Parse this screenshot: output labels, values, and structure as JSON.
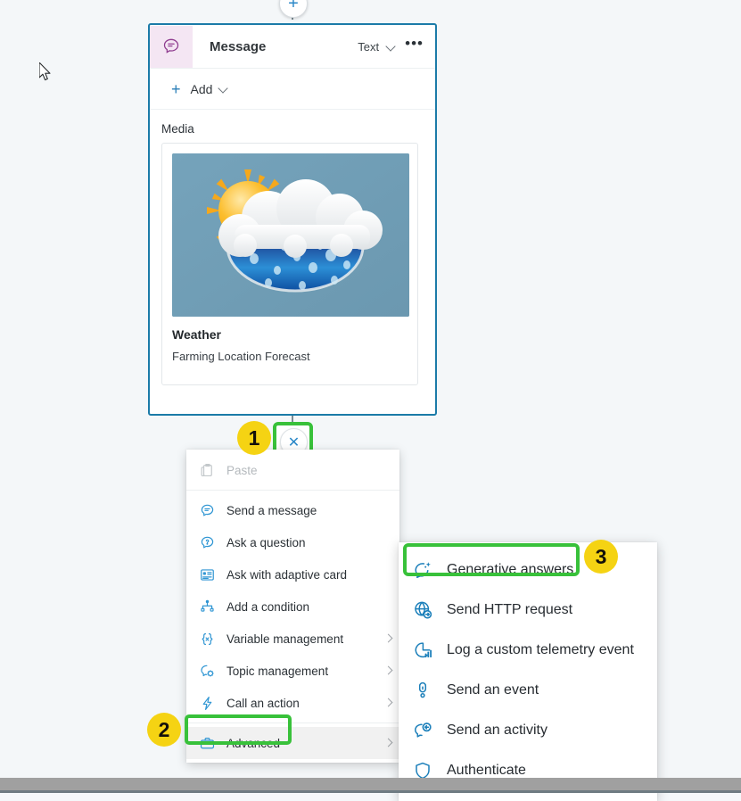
{
  "node": {
    "icon": "message-bubble-icon",
    "title": "Message",
    "header_select_value": "Text",
    "header_chevron": "chevron-down-icon",
    "header_more": "•••",
    "add_label": "Add",
    "add_plus": "+",
    "add_chevron": "chevron-down-icon",
    "media_label": "Media",
    "media_title": "Weather",
    "media_subtitle": "Farming Location Forecast",
    "media_image_alt": "weather-sun-cloud-rain-illustration"
  },
  "canvas": {
    "add_node_glyph": "+",
    "close_node_glyph": "✕"
  },
  "badges": [
    {
      "id": "badge-1",
      "label": "1"
    },
    {
      "id": "badge-2",
      "label": "2"
    },
    {
      "id": "badge-3",
      "label": "3"
    }
  ],
  "context_menu": {
    "items": [
      {
        "label": "Paste",
        "icon": "clipboard-icon",
        "disabled": true,
        "caret": false,
        "selected": false,
        "separator_after": true
      },
      {
        "label": "Send a message",
        "icon": "message-bubble-icon",
        "disabled": false,
        "caret": false,
        "selected": false,
        "separator_after": false
      },
      {
        "label": "Ask a question",
        "icon": "question-bubble-icon",
        "disabled": false,
        "caret": false,
        "selected": false,
        "separator_after": false
      },
      {
        "label": "Ask with adaptive card",
        "icon": "adaptive-card-icon",
        "disabled": false,
        "caret": false,
        "selected": false,
        "separator_after": false
      },
      {
        "label": "Add a condition",
        "icon": "branch-condition-icon",
        "disabled": false,
        "caret": false,
        "selected": false,
        "separator_after": false
      },
      {
        "label": "Variable management",
        "icon": "variable-braces-icon",
        "disabled": false,
        "caret": true,
        "selected": false,
        "separator_after": false
      },
      {
        "label": "Topic management",
        "icon": "topic-gear-icon",
        "disabled": false,
        "caret": true,
        "selected": false,
        "separator_after": false
      },
      {
        "label": "Call an action",
        "icon": "lightning-bolt-icon",
        "disabled": false,
        "caret": true,
        "selected": false,
        "separator_after": true
      },
      {
        "label": "Advanced",
        "icon": "briefcase-icon",
        "disabled": false,
        "caret": true,
        "selected": true,
        "separator_after": false
      }
    ]
  },
  "submenu": {
    "items": [
      {
        "label": "Generative answers",
        "icon": "sparkle-bubble-icon"
      },
      {
        "label": "Send HTTP request",
        "icon": "globe-request-icon"
      },
      {
        "label": "Log a custom telemetry event",
        "icon": "pie-chart-bars-icon"
      },
      {
        "label": "Send an event",
        "icon": "event-alert-icon"
      },
      {
        "label": "Send an activity",
        "icon": "activity-bubble-icon"
      },
      {
        "label": "Authenticate",
        "icon": "shield-icon"
      }
    ]
  },
  "colors": {
    "node_border": "#1b7ba8",
    "highlight_green": "#38c13a",
    "badge_yellow": "#f5d313",
    "accent_blue": "#2e95d3",
    "icon_purple": "#8e3b8e"
  }
}
